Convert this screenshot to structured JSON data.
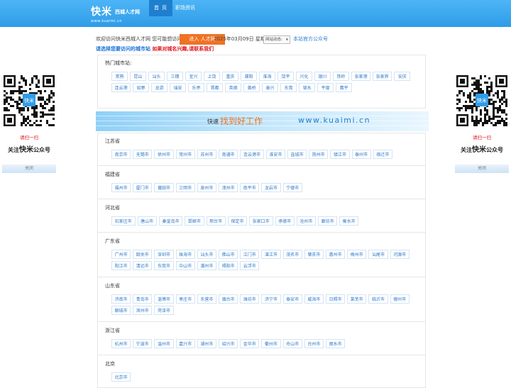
{
  "header": {
    "logo": "快米",
    "logo_sub": "西城人才网",
    "logo_url": "www.kuaimi.cn",
    "nav": [
      "首页",
      "职场资讯"
    ]
  },
  "info": {
    "welcome": "欢迎访问快米西城人才网 您可能想访问",
    "enter_button": "进入 人才网",
    "date": "2025年03月09日 星期日",
    "nav_select": "网站动态:",
    "official": "本站官方公众号"
  },
  "tip": {
    "choose": "请选择您要访问的城市站",
    "contact": "如果对城名兴趣,请联系我们"
  },
  "hot": {
    "title": "热门城市站:",
    "cities": [
      "常熟",
      "昆山",
      "汕头",
      "三穗",
      "宜兴",
      "上饶",
      "重庆",
      "濮阳",
      "淮海",
      "饶平",
      "兴化",
      "银川",
      "铁岭",
      "张家港",
      "张家界",
      "安庆",
      "连云港",
      "如皋",
      "龙游",
      "瑞安",
      "乐亭",
      "晋都",
      "英德",
      "黄桥",
      "泰兴",
      "东莞",
      "邹水",
      "平度",
      "鹰平"
    ]
  },
  "banner": {
    "small": "快速",
    "big": "找到好工作",
    "url": "www.kuaimi.cn"
  },
  "provinces": [
    {
      "name": "江苏省",
      "cities": [
        "南京市",
        "无锡市",
        "徐州市",
        "常州市",
        "苏州市",
        "南通市",
        "连云港市",
        "淮安市",
        "盐城市",
        "扬州市",
        "镇江市",
        "泰州市",
        "宿迁市"
      ]
    },
    {
      "name": "福建省",
      "cities": [
        "福州市",
        "厦门市",
        "莆田市",
        "三明市",
        "泉州市",
        "漳州市",
        "南平市",
        "龙岩市",
        "宁德市"
      ]
    },
    {
      "name": "河北省",
      "cities": [
        "石家庄市",
        "唐山市",
        "秦皇岛市",
        "邯郸市",
        "邢台市",
        "保定市",
        "张家口市",
        "承德市",
        "沧州市",
        "廊坊市",
        "衡水市"
      ]
    },
    {
      "name": "广东省",
      "cities": [
        "广州市",
        "韶关市",
        "深圳市",
        "珠海市",
        "汕头市",
        "佛山市",
        "江门市",
        "湛江市",
        "茂名市",
        "肇庆市",
        "惠州市",
        "梅州市",
        "汕尾市",
        "河源市",
        "阳江市",
        "清远市",
        "东莞市",
        "中山市",
        "潮州市",
        "揭阳市",
        "云浮市"
      ]
    },
    {
      "name": "山东省",
      "cities": [
        "济南市",
        "青岛市",
        "淄博市",
        "枣庄市",
        "东营市",
        "烟台市",
        "潍坊市",
        "济宁市",
        "泰安市",
        "威海市",
        "日照市",
        "莱芜市",
        "临沂市",
        "德州市",
        "聊城市",
        "滨州市",
        "菏泽市"
      ]
    },
    {
      "name": "浙江省",
      "cities": [
        "杭州市",
        "宁波市",
        "温州市",
        "嘉兴市",
        "湖州市",
        "绍兴市",
        "金华市",
        "衢州市",
        "舟山市",
        "台州市",
        "丽水市"
      ]
    },
    {
      "name": "北京",
      "cities": [
        "北京市"
      ]
    }
  ],
  "side": {
    "qr_badge": "快米",
    "scan": "请扫一扫",
    "follow_prefix": "关注",
    "follow_brand": "快米",
    "follow_suffix": "公众号",
    "close": "关闭"
  },
  "colors": {
    "header_blue": "#3aa6ee",
    "nav_active": "#1e7fcf",
    "enter_orange": "#f07224",
    "link_blue": "#2b76c8",
    "tip_red": "#e0141e"
  }
}
